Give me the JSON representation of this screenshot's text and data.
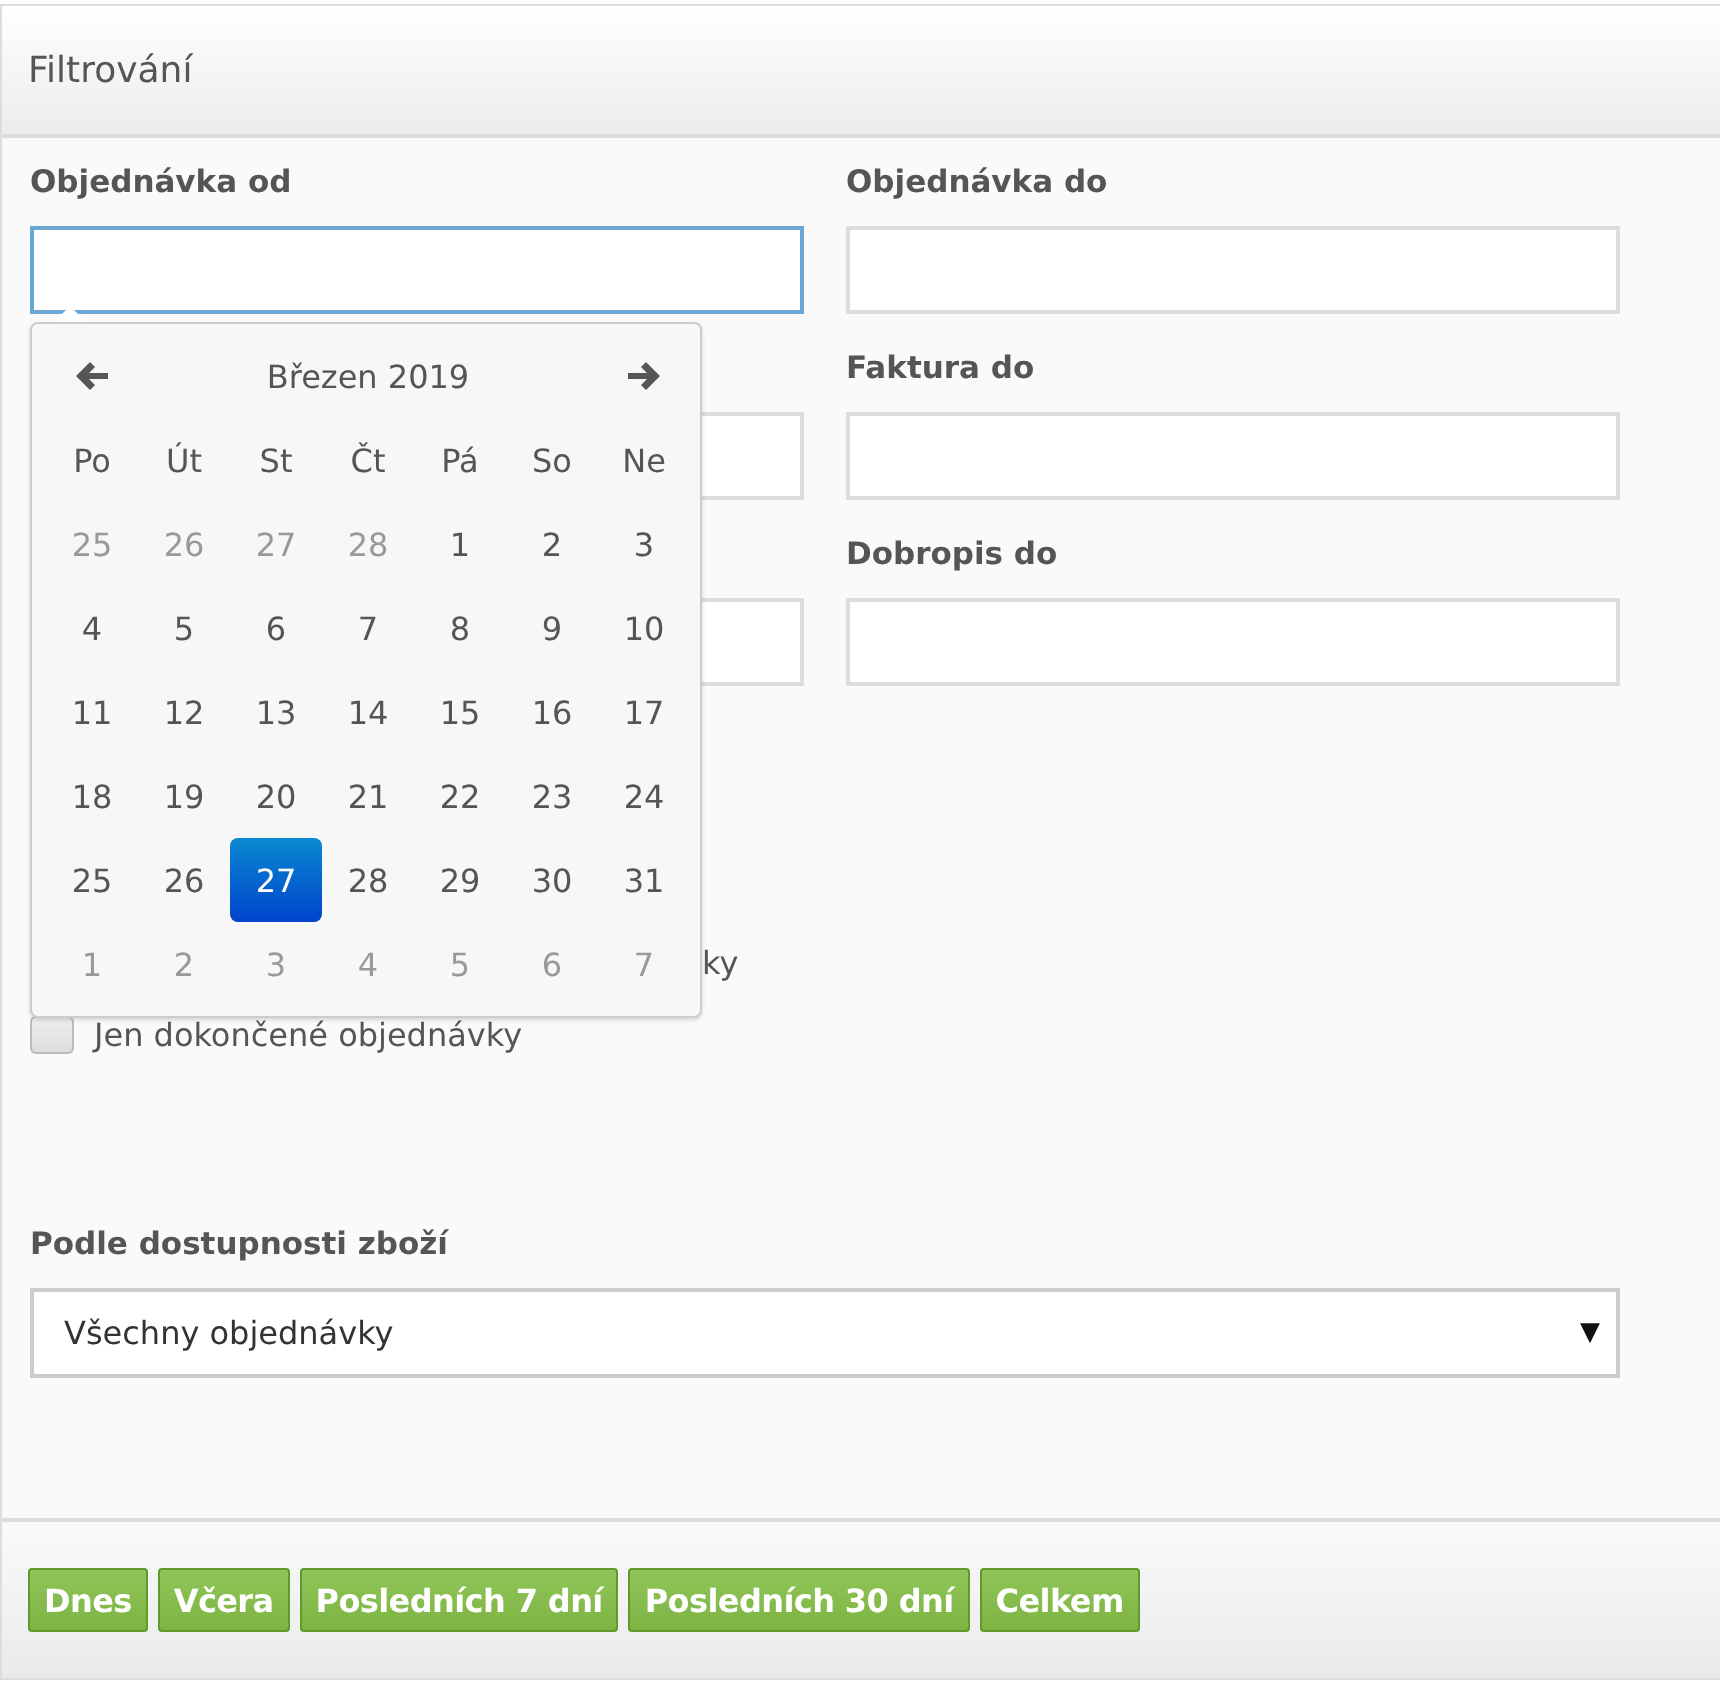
{
  "panel": {
    "title": "Filtrování"
  },
  "fields": [
    {
      "label": "Objednávka od",
      "focused": true
    },
    {
      "label": "Objednávka do",
      "focused": false
    },
    {
      "focused": false
    },
    {
      "label": "Faktura do",
      "focused": false
    },
    {
      "focused": false
    },
    {
      "label": "Dobropis do",
      "focused": false
    }
  ],
  "checkboxes": [
    {
      "kind": "covered",
      "label": "ky"
    },
    {
      "kind": "plain",
      "label": "Jen dokončené objednávky",
      "checked": false
    }
  ],
  "select": {
    "label": "Podle dostupnosti zboží",
    "value": "Všechny objednávky",
    "arrow": "▼"
  },
  "buttons": [
    "Dnes",
    "Včera",
    "Posledních 7 dní",
    "Posledních 30 dní",
    "Celkem"
  ],
  "datepicker": {
    "month": "Březen 2019",
    "weekdays": [
      "Po",
      "Út",
      "St",
      "Čt",
      "Pá",
      "So",
      "Ne"
    ],
    "weeks": [
      [
        {
          "day": "25",
          "other_month": true,
          "selected": false
        },
        {
          "day": "26",
          "other_month": true,
          "selected": false
        },
        {
          "day": "27",
          "other_month": true,
          "selected": false
        },
        {
          "day": "28",
          "other_month": true,
          "selected": false
        },
        {
          "day": "1",
          "other_month": false,
          "selected": false
        },
        {
          "day": "2",
          "other_month": false,
          "selected": false
        },
        {
          "day": "3",
          "other_month": false,
          "selected": false
        }
      ],
      [
        {
          "day": "4",
          "other_month": false,
          "selected": false
        },
        {
          "day": "5",
          "other_month": false,
          "selected": false
        },
        {
          "day": "6",
          "other_month": false,
          "selected": false
        },
        {
          "day": "7",
          "other_month": false,
          "selected": false
        },
        {
          "day": "8",
          "other_month": false,
          "selected": false
        },
        {
          "day": "9",
          "other_month": false,
          "selected": false
        },
        {
          "day": "10",
          "other_month": false,
          "selected": false
        }
      ],
      [
        {
          "day": "11",
          "other_month": false,
          "selected": false
        },
        {
          "day": "12",
          "other_month": false,
          "selected": false
        },
        {
          "day": "13",
          "other_month": false,
          "selected": false
        },
        {
          "day": "14",
          "other_month": false,
          "selected": false
        },
        {
          "day": "15",
          "other_month": false,
          "selected": false
        },
        {
          "day": "16",
          "other_month": false,
          "selected": false
        },
        {
          "day": "17",
          "other_month": false,
          "selected": false
        }
      ],
      [
        {
          "day": "18",
          "other_month": false,
          "selected": false
        },
        {
          "day": "19",
          "other_month": false,
          "selected": false
        },
        {
          "day": "20",
          "other_month": false,
          "selected": false
        },
        {
          "day": "21",
          "other_month": false,
          "selected": false
        },
        {
          "day": "22",
          "other_month": false,
          "selected": false
        },
        {
          "day": "23",
          "other_month": false,
          "selected": false
        },
        {
          "day": "24",
          "other_month": false,
          "selected": false
        }
      ],
      [
        {
          "day": "25",
          "other_month": false,
          "selected": false
        },
        {
          "day": "26",
          "other_month": false,
          "selected": false
        },
        {
          "day": "27",
          "other_month": false,
          "selected": true
        },
        {
          "day": "28",
          "other_month": false,
          "selected": false
        },
        {
          "day": "29",
          "other_month": false,
          "selected": false
        },
        {
          "day": "30",
          "other_month": false,
          "selected": false
        },
        {
          "day": "31",
          "other_month": false,
          "selected": false
        }
      ],
      [
        {
          "day": "1",
          "other_month": true,
          "selected": false
        },
        {
          "day": "2",
          "other_month": true,
          "selected": false
        },
        {
          "day": "3",
          "other_month": true,
          "selected": false
        },
        {
          "day": "4",
          "other_month": true,
          "selected": false
        },
        {
          "day": "5",
          "other_month": true,
          "selected": false
        },
        {
          "day": "6",
          "other_month": true,
          "selected": false
        },
        {
          "day": "7",
          "other_month": true,
          "selected": false
        }
      ]
    ]
  }
}
